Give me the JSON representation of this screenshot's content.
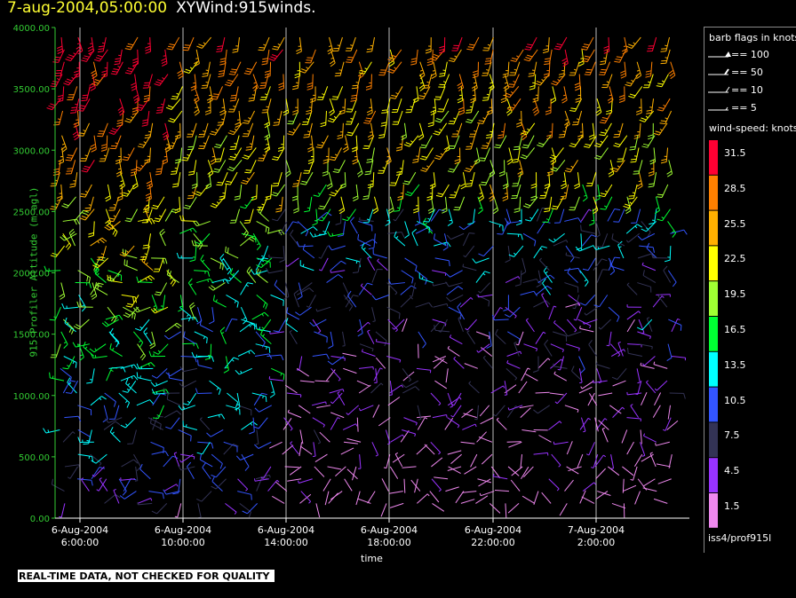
{
  "title": {
    "time": "7-aug-2004,05:00:00",
    "main": "XYWind:915winds."
  },
  "footer": "REAL-TIME DATA, NOT CHECKED FOR QUALITY",
  "source": "iss4/prof915l",
  "legend": {
    "flags_title": "barb flags in knots",
    "flags": [
      "== 100",
      "== 50",
      "== 10",
      "== 5"
    ],
    "speed_title": "wind-speed: knots",
    "bins": [
      {
        "label": "31.5",
        "color": "#ff0033"
      },
      {
        "label": "28.5",
        "color": "#ff8000"
      },
      {
        "label": "25.5",
        "color": "#ffb000"
      },
      {
        "label": "22.5",
        "color": "#ffff00"
      },
      {
        "label": "19.5",
        "color": "#a0ff33"
      },
      {
        "label": "16.5",
        "color": "#00ff33"
      },
      {
        "label": "13.5",
        "color": "#00ffff"
      },
      {
        "label": "10.5",
        "color": "#3355ff"
      },
      {
        "label": "7.5",
        "color": "#333355"
      },
      {
        "label": "4.5",
        "color": "#9933ff"
      },
      {
        "label": "1.5",
        "color": "#ee88ee"
      }
    ]
  },
  "chart_data": {
    "type": "scatter",
    "title": "7-aug-2004,05:00:00  XYWind:915winds.",
    "xlabel": "time",
    "ylabel": "915 Profiler Altitude (m agl)",
    "ylim": [
      0,
      4000
    ],
    "yticks": [
      "0.00",
      "500.00",
      "1000.00",
      "1500.00",
      "2000.00",
      "2500.00",
      "3000.00",
      "3500.00",
      "4000.00"
    ],
    "xticks": [
      {
        "date": "6-Aug-2004",
        "time": "6:00:00"
      },
      {
        "date": "6-Aug-2004",
        "time": "10:00:00"
      },
      {
        "date": "6-Aug-2004",
        "time": "14:00:00"
      },
      {
        "date": "6-Aug-2004",
        "time": "18:00:00"
      },
      {
        "date": "6-Aug-2004",
        "time": "22:00:00"
      },
      {
        "date": "7-Aug-2004",
        "time": "2:00:00"
      }
    ],
    "grid": "vertical",
    "legend_position": "right",
    "series": [
      {
        "altitude_band": [
          0,
          1000
        ],
        "typical_speed_kt": [
          1.5,
          10.5
        ]
      },
      {
        "altitude_band": [
          1000,
          2000
        ],
        "typical_speed_kt": [
          4.5,
          13.5
        ]
      },
      {
        "altitude_band": [
          2000,
          3000
        ],
        "typical_speed_kt": [
          7.5,
          25.5
        ]
      },
      {
        "altitude_band": [
          3000,
          4000
        ],
        "typical_speed_kt": [
          13.5,
          31.5
        ]
      }
    ]
  }
}
